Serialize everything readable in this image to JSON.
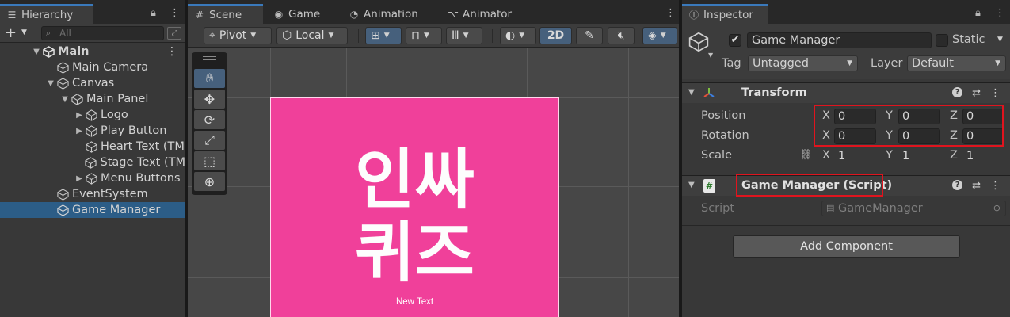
{
  "hierarchy": {
    "tab_label": "Hierarchy",
    "search_placeholder": "All",
    "items": [
      {
        "label": "Main",
        "arrow": "▼"
      },
      {
        "label": "Main Camera",
        "arrow": ""
      },
      {
        "label": "Canvas",
        "arrow": "▼"
      },
      {
        "label": "Main Panel",
        "arrow": "▼"
      },
      {
        "label": "Logo",
        "arrow": "▶"
      },
      {
        "label": "Play Button",
        "arrow": "▶"
      },
      {
        "label": "Heart Text (TM",
        "arrow": ""
      },
      {
        "label": "Stage Text (TM",
        "arrow": ""
      },
      {
        "label": "Menu Buttons",
        "arrow": "▶"
      },
      {
        "label": "EventSystem",
        "arrow": ""
      },
      {
        "label": "Game Manager",
        "arrow": "",
        "selected": true
      }
    ]
  },
  "scene": {
    "tabs": [
      {
        "label": "Scene",
        "icon": "#"
      },
      {
        "label": "Game",
        "icon": "◉"
      },
      {
        "label": "Animation",
        "icon": "◔"
      },
      {
        "label": "Animator",
        "icon": "⌥"
      }
    ],
    "toolbar": {
      "pivot_label": "Pivot",
      "local_label": "Local",
      "mode_2d_label": "2D"
    },
    "canvas_title_line1": "인싸",
    "canvas_title_line2": "퀴즈",
    "canvas_new_text": "New Text",
    "canvas_color": "#f0409a"
  },
  "inspector": {
    "tab_label": "Inspector",
    "object_name": "Game Manager",
    "static_label": "Static",
    "tag_label": "Tag",
    "tag_value": "Untagged",
    "layer_label": "Layer",
    "layer_value": "Default",
    "transform": {
      "title": "Transform",
      "position_label": "Position",
      "rotation_label": "Rotation",
      "scale_label": "Scale",
      "axis_x": "X",
      "axis_y": "Y",
      "axis_z": "Z",
      "position": {
        "x": "0",
        "y": "0",
        "z": "0"
      },
      "rotation": {
        "x": "0",
        "y": "0",
        "z": "0"
      },
      "scale": {
        "x": "1",
        "y": "1",
        "z": "1"
      }
    },
    "script_component": {
      "title": "Game Manager (Script)",
      "script_label": "Script",
      "script_value": "GameManager"
    },
    "add_component_label": "Add Component"
  },
  "colors": {
    "accent_blue": "#3a79bb",
    "selection": "#2c5d87",
    "highlight_red": "#e0141e"
  }
}
